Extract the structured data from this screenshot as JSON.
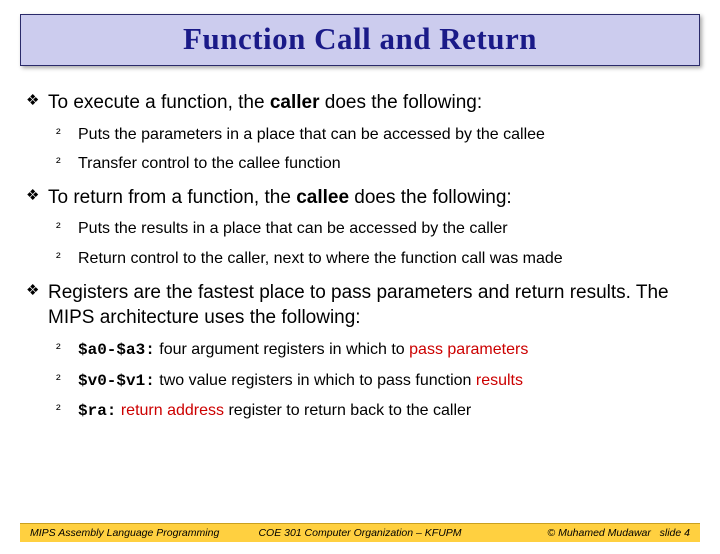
{
  "title": "Function Call and Return",
  "p1": {
    "prefix": "To execute a function, the ",
    "bold": "caller",
    "suffix": " does the following:"
  },
  "s1a": "Puts the parameters in a place that can be accessed by the callee",
  "s1b": "Transfer control to the callee function",
  "p2": {
    "prefix": "To return from a function, the ",
    "bold": "callee",
    "suffix": " does the following:"
  },
  "s2a": "Puts the results in a place that can be accessed by the caller",
  "s2b": "Return control to the caller, next to where the function call was made",
  "p3": "Registers are the fastest place to pass parameters and return results. The MIPS architecture uses the following:",
  "s3a": {
    "code": "$a0-$a3:",
    "txt": " four argument registers in which to ",
    "red": "pass parameters"
  },
  "s3b": {
    "code": "$v0-$v1:",
    "txt": " two value registers in which to pass function ",
    "red": "results"
  },
  "s3c": {
    "code": "$ra:",
    "red": " return address",
    "txt": " register to return back to the caller"
  },
  "footer": {
    "left": "MIPS Assembly Language Programming",
    "center": "COE 301 Computer Organization – KFUPM",
    "right_author": "© Muhamed Mudawar",
    "right_slide": "slide 4"
  },
  "bullets": {
    "lvl1": "❖",
    "lvl2": "²"
  }
}
